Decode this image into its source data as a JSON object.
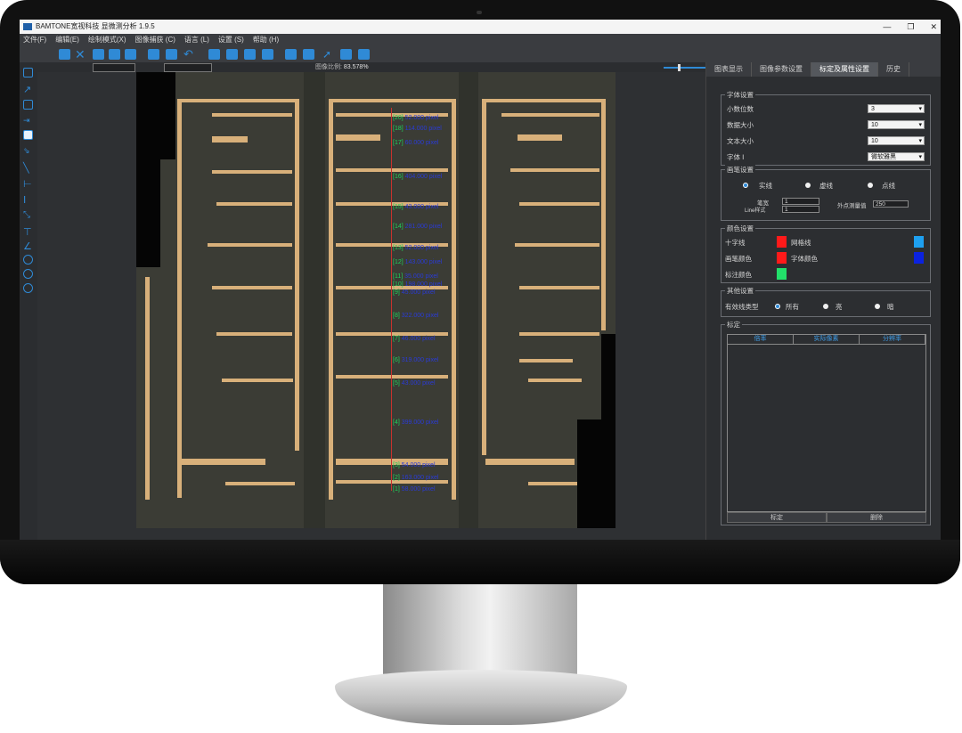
{
  "window": {
    "title": "BAMTONE宽视科技 显微测分析 1.9.5",
    "minimize": "—",
    "maximize": "❐",
    "close": "✕"
  },
  "menu": [
    "文件(F)",
    "编辑(E)",
    "绘制模式(X)",
    "图像捕获 (C)",
    "语言 (L)",
    "设置 (S)",
    "帮助 (H)"
  ],
  "options": {
    "zoom_label": "图像比例:",
    "zoom_value": "83.578%"
  },
  "tabs": [
    "图表显示",
    "图像参数设置",
    "标定及属性设置",
    "历史"
  ],
  "font_settings": {
    "title": "字体设置",
    "rows": [
      {
        "label": "小数位数",
        "value": "3"
      },
      {
        "label": "数据大小",
        "value": "10"
      },
      {
        "label": "文本大小",
        "value": "10"
      },
      {
        "label": "字体 Ⅰ",
        "value": "微软雅黑"
      }
    ]
  },
  "pen_settings": {
    "title": "画笔设置",
    "styles": [
      "实线",
      "虚线",
      "点线"
    ],
    "width_label": "笔宽",
    "width_value": "1",
    "line_label": "Line样式",
    "line_value": "1",
    "outer_label": "外点测量值",
    "outer_value": "250"
  },
  "color_settings": {
    "title": "颜色设置",
    "items": [
      {
        "label": "十字线",
        "color": "#ff1a1a"
      },
      {
        "label": "网格线",
        "color": "#1ea0f0"
      },
      {
        "label": "画笔颜色",
        "color": "#ff1a1a"
      },
      {
        "label": "字体颜色",
        "color": "#0b22e0"
      },
      {
        "label": "标注颜色",
        "color": "#22e06a"
      }
    ]
  },
  "other_settings": {
    "title": "其他设置",
    "label": "有效线类型",
    "options": [
      "所有",
      "亮",
      "暗"
    ]
  },
  "calibration": {
    "title": "标定",
    "columns": [
      "倍率",
      "实际像素",
      "分辨率"
    ],
    "buttons": [
      "标定",
      "删除"
    ]
  },
  "measurements": [
    {
      "num": "[20]",
      "text": "52.000 pixel"
    },
    {
      "num": "[18]",
      "text": "114.000 pixel"
    },
    {
      "num": "[17]",
      "text": "60.000 pixel"
    },
    {
      "num": "[16]",
      "text": "404.000 pixel"
    },
    {
      "num": "[15]",
      "text": "43.000 pixel"
    },
    {
      "num": "[14]",
      "text": "281.000 pixel"
    },
    {
      "num": "[13]",
      "text": "52.000 pixel"
    },
    {
      "num": "[12]",
      "text": "143.000 pixel"
    },
    {
      "num": "[11]",
      "text": "35.000 pixel"
    },
    {
      "num": "[10]",
      "text": "198.000 pixel"
    },
    {
      "num": "[9]",
      "text": "45.000 pixel"
    },
    {
      "num": "[8]",
      "text": "322.000 pixel"
    },
    {
      "num": "[7]",
      "text": "46.000 pixel"
    },
    {
      "num": "[6]",
      "text": "319.000 pixel"
    },
    {
      "num": "[5]",
      "text": "43.000 pixel"
    },
    {
      "num": "[4]",
      "text": "399.000 pixel"
    },
    {
      "num": "[3]",
      "text": "54.000 pixel"
    },
    {
      "num": "[2]",
      "text": "163.000 pixel"
    },
    {
      "num": "[1]",
      "text": "58.000 pixel"
    }
  ]
}
